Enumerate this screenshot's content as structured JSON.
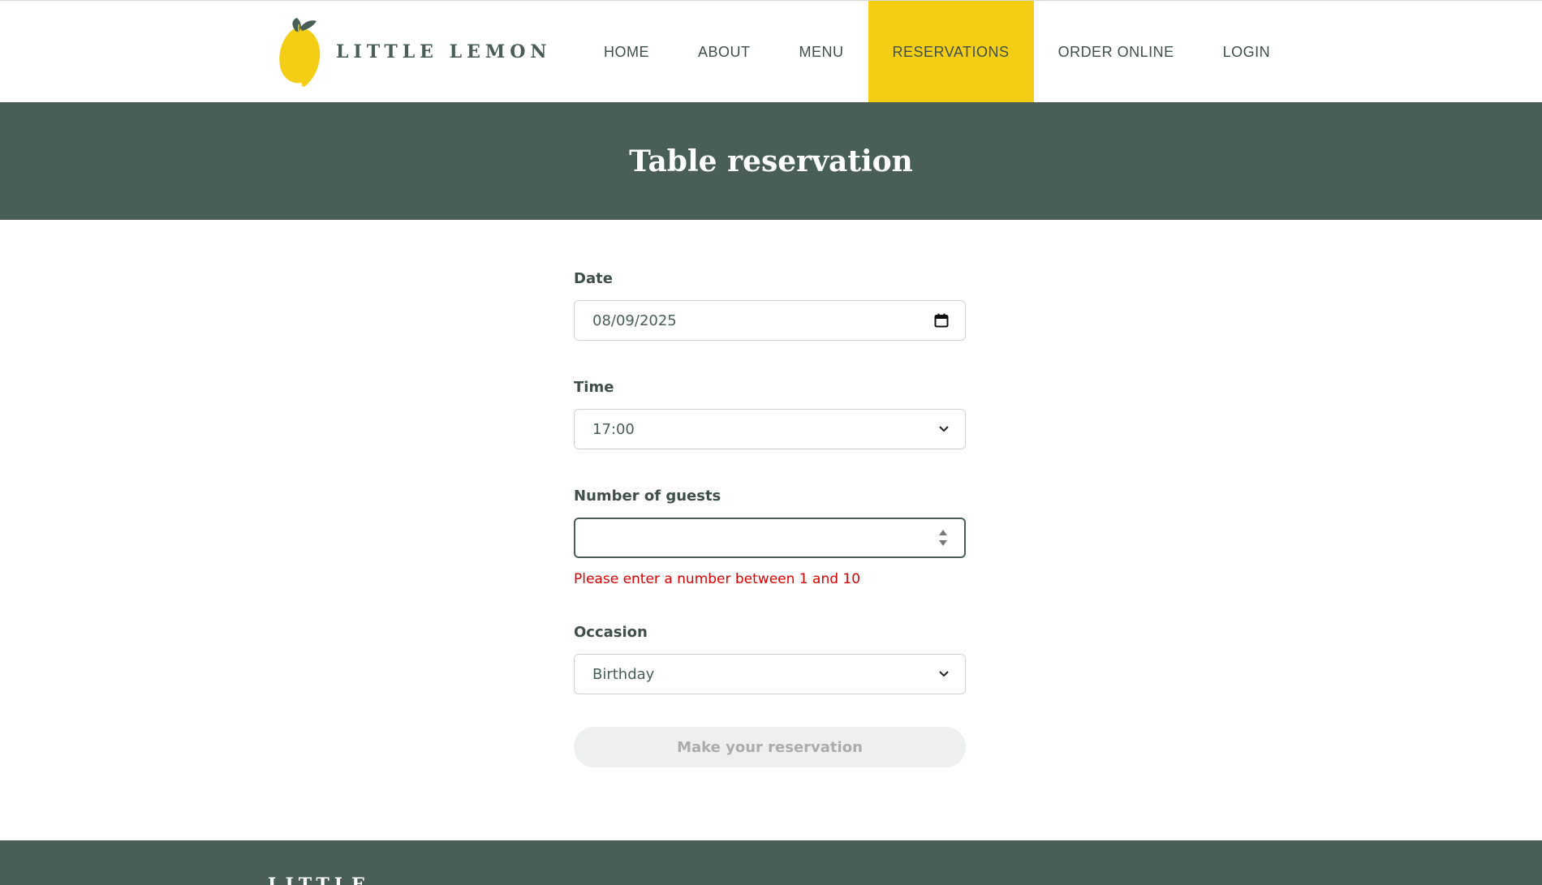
{
  "brand": {
    "name": "LITTLE LEMON",
    "colors": {
      "primary": "#495e57",
      "accent": "#f4ce14",
      "error": "#e00000"
    }
  },
  "nav": {
    "items": [
      {
        "label": "HOME"
      },
      {
        "label": "ABOUT"
      },
      {
        "label": "MENU"
      },
      {
        "label": "RESERVATIONS",
        "active": true
      },
      {
        "label": "ORDER ONLINE"
      },
      {
        "label": "LOGIN"
      }
    ]
  },
  "hero": {
    "title": "Table reservation"
  },
  "form": {
    "date": {
      "label": "Date",
      "value": "08/09/2025",
      "icon": "calendar-icon"
    },
    "time": {
      "label": "Time",
      "value": "17:00",
      "icon": "chevron-down-icon"
    },
    "guests": {
      "label": "Number of guests",
      "value": "",
      "error": "Please enter a number between 1 and 10",
      "icon": "spinner-arrows-icon"
    },
    "occasion": {
      "label": "Occasion",
      "value": "Birthday",
      "icon": "chevron-down-icon"
    },
    "submit": {
      "label": "Make your reservation",
      "disabled": true
    }
  },
  "footer": {
    "logo_text": "LITTLE"
  }
}
